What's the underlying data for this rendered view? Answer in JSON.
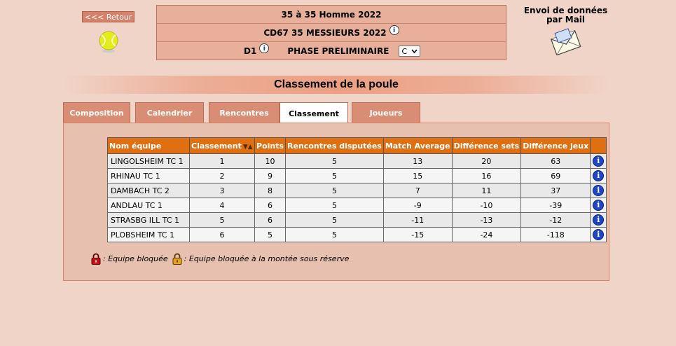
{
  "nav": {
    "back_label": "<<< Retour"
  },
  "header": {
    "line1": "35 à 35 Homme 2022",
    "line2": "CD67 35 MESSIEURS 2022",
    "level": "D1",
    "phase": "PHASE PRELIMINAIRE",
    "poule_select": "C"
  },
  "mail": {
    "label_line1": "Envoi de données",
    "label_line2": "par Mail"
  },
  "page_title": "Classement de la poule",
  "tabs": [
    {
      "label": "Composition",
      "active": false
    },
    {
      "label": "Calendrier",
      "active": false
    },
    {
      "label": "Rencontres",
      "active": false
    },
    {
      "label": "Classement",
      "active": true
    },
    {
      "label": "Joueurs",
      "active": false
    }
  ],
  "table": {
    "headers": [
      "Nom équipe",
      "Classement",
      "Points",
      "Rencontres disputées",
      "Match Average",
      "Différence sets",
      "Différence jeux",
      ""
    ],
    "rows": [
      {
        "name": "LINGOLSHEIM TC 1",
        "rank": "1",
        "points": "10",
        "played": "5",
        "match_avg": "13",
        "diff_sets": "20",
        "diff_games": "63"
      },
      {
        "name": "RHINAU TC 1",
        "rank": "2",
        "points": "9",
        "played": "5",
        "match_avg": "15",
        "diff_sets": "16",
        "diff_games": "69"
      },
      {
        "name": "DAMBACH TC 2",
        "rank": "3",
        "points": "8",
        "played": "5",
        "match_avg": "7",
        "diff_sets": "11",
        "diff_games": "37"
      },
      {
        "name": "ANDLAU TC 1",
        "rank": "4",
        "points": "6",
        "played": "5",
        "match_avg": "-9",
        "diff_sets": "-10",
        "diff_games": "-39"
      },
      {
        "name": "STRASBG ILL TC 1",
        "rank": "5",
        "points": "6",
        "played": "5",
        "match_avg": "-11",
        "diff_sets": "-13",
        "diff_games": "-12"
      },
      {
        "name": "PLOBSHEIM TC 1",
        "rank": "6",
        "points": "5",
        "played": "5",
        "match_avg": "-15",
        "diff_sets": "-24",
        "diff_games": "-118"
      }
    ]
  },
  "legend": {
    "locked": ": Equipe bloquée",
    "locked_reserve": ": Equipe bloquée à la montée sous réserve"
  },
  "colors": {
    "background": "#f0d4c8",
    "header_box": "#e8b09a",
    "table_header": "#e06f12",
    "tab": "#d88d74",
    "info_blue": "#1f46c7"
  }
}
